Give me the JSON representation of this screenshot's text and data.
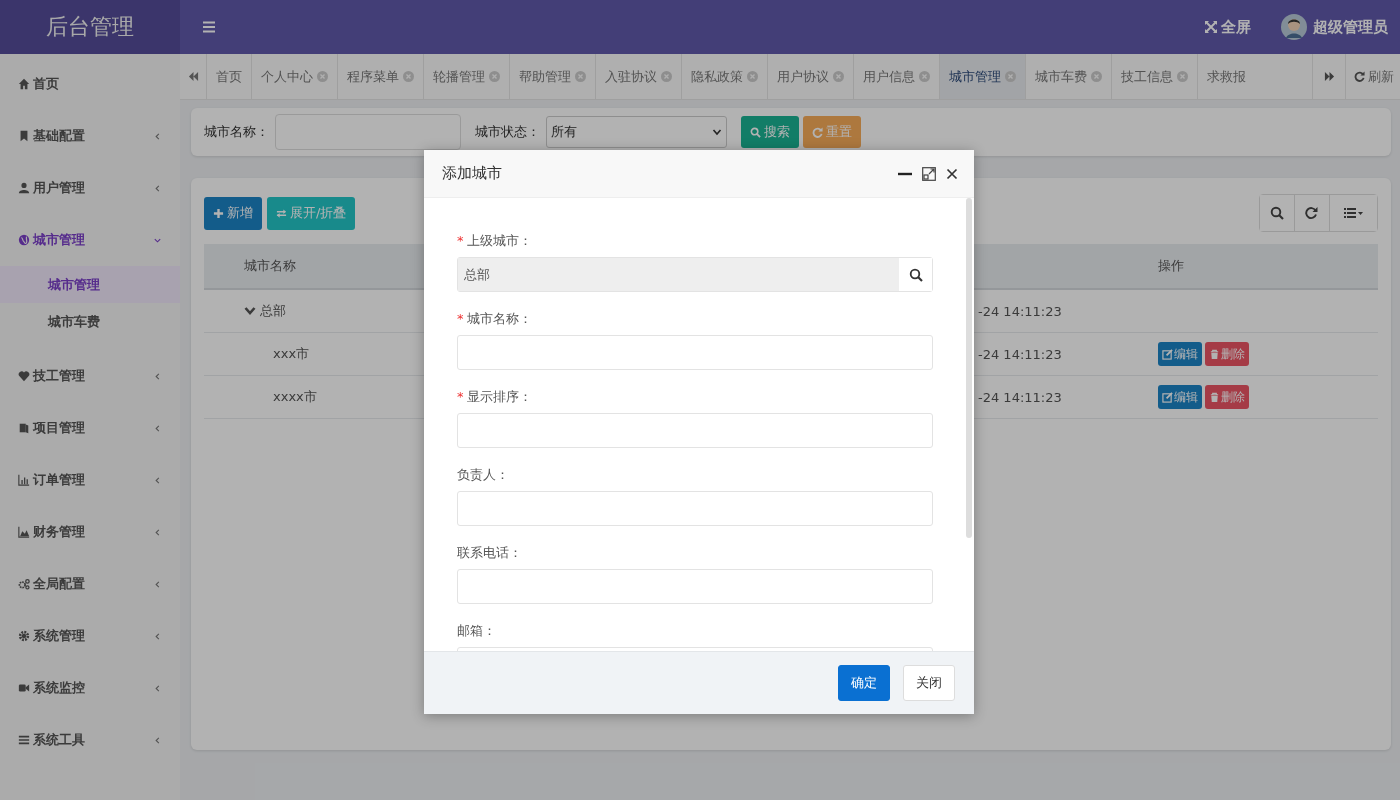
{
  "brand": "后台管理",
  "header": {
    "fullscreen": "全屏",
    "user": "超级管理员"
  },
  "sidebar": {
    "items": [
      {
        "label": "首页",
        "kind": "link"
      },
      {
        "label": "基础配置",
        "kind": "group",
        "expanded": false
      },
      {
        "label": "用户管理",
        "kind": "group",
        "expanded": false
      },
      {
        "label": "城市管理",
        "kind": "group",
        "expanded": true,
        "children": [
          {
            "label": "城市管理",
            "selected": true
          },
          {
            "label": "城市车费",
            "selected": false
          }
        ]
      },
      {
        "label": "技工管理",
        "kind": "group",
        "expanded": false
      },
      {
        "label": "项目管理",
        "kind": "group",
        "expanded": false
      },
      {
        "label": "订单管理",
        "kind": "group",
        "expanded": false
      },
      {
        "label": "财务管理",
        "kind": "group",
        "expanded": false
      },
      {
        "label": "全局配置",
        "kind": "group",
        "expanded": false
      },
      {
        "label": "系统管理",
        "kind": "group",
        "expanded": false
      },
      {
        "label": "系统监控",
        "kind": "group",
        "expanded": false
      },
      {
        "label": "系统工具",
        "kind": "group",
        "expanded": false
      }
    ]
  },
  "tabs": [
    {
      "label": "首页",
      "selected": false,
      "closable": false
    },
    {
      "label": "个人中心",
      "selected": false,
      "closable": true
    },
    {
      "label": "程序菜单",
      "selected": false,
      "closable": true
    },
    {
      "label": "轮播管理",
      "selected": false,
      "closable": true
    },
    {
      "label": "帮助管理",
      "selected": false,
      "closable": true
    },
    {
      "label": "入驻协议",
      "selected": false,
      "closable": true
    },
    {
      "label": "隐私政策",
      "selected": false,
      "closable": true
    },
    {
      "label": "用户协议",
      "selected": false,
      "closable": true
    },
    {
      "label": "用户信息",
      "selected": false,
      "closable": true
    },
    {
      "label": "城市管理",
      "selected": true,
      "closable": true
    },
    {
      "label": "城市车费",
      "selected": false,
      "closable": true
    },
    {
      "label": "技工信息",
      "selected": false,
      "closable": true
    },
    {
      "label": "求救报",
      "selected": false,
      "closable": false
    }
  ],
  "tab_refresh": "刷新",
  "search": {
    "fields": [
      {
        "label": "城市名称：",
        "kind": "text"
      },
      {
        "label": "城市状态：",
        "kind": "select",
        "value": "所有"
      }
    ],
    "buttons": [
      {
        "label": "搜索",
        "kind": "search"
      },
      {
        "label": "重置",
        "kind": "reset"
      }
    ]
  },
  "toolbar": {
    "buttons": [
      {
        "label": "新增",
        "kind": "add"
      },
      {
        "label": "展开/折叠",
        "kind": "toggle"
      }
    ]
  },
  "table": {
    "columns": [
      "城市名称",
      "操作"
    ],
    "rows": [
      {
        "name": "总部",
        "expanded": true,
        "column_2": "-24 14:11:23",
        "children": [
          {
            "name": "xxx市",
            "column_2": "-24 14:11:23",
            "actions": [
              {
                "label": "编辑",
                "kind": "edit"
              },
              {
                "label": "删除",
                "kind": "delete"
              }
            ]
          },
          {
            "name": "xxxx市",
            "column_2": "-24 14:11:23",
            "actions": [
              {
                "label": "编辑",
                "kind": "edit"
              },
              {
                "label": "删除",
                "kind": "delete"
              }
            ]
          }
        ]
      }
    ]
  },
  "modal": {
    "title": "添加城市",
    "fields": [
      {
        "marker": "*",
        "label": "上级城市：",
        "kind": "lookup",
        "value": "总部"
      },
      {
        "marker": "*",
        "label": "城市名称：",
        "kind": "text"
      },
      {
        "marker": "*",
        "label": "显示排序：",
        "kind": "text"
      },
      {
        "label": "负责人：",
        "kind": "text"
      },
      {
        "label": "联系电话：",
        "kind": "text"
      },
      {
        "label": "邮箱：",
        "kind": "text"
      }
    ],
    "buttons": [
      {
        "label": "确定",
        "primary": true
      },
      {
        "label": "关闭",
        "primary": false
      }
    ]
  }
}
